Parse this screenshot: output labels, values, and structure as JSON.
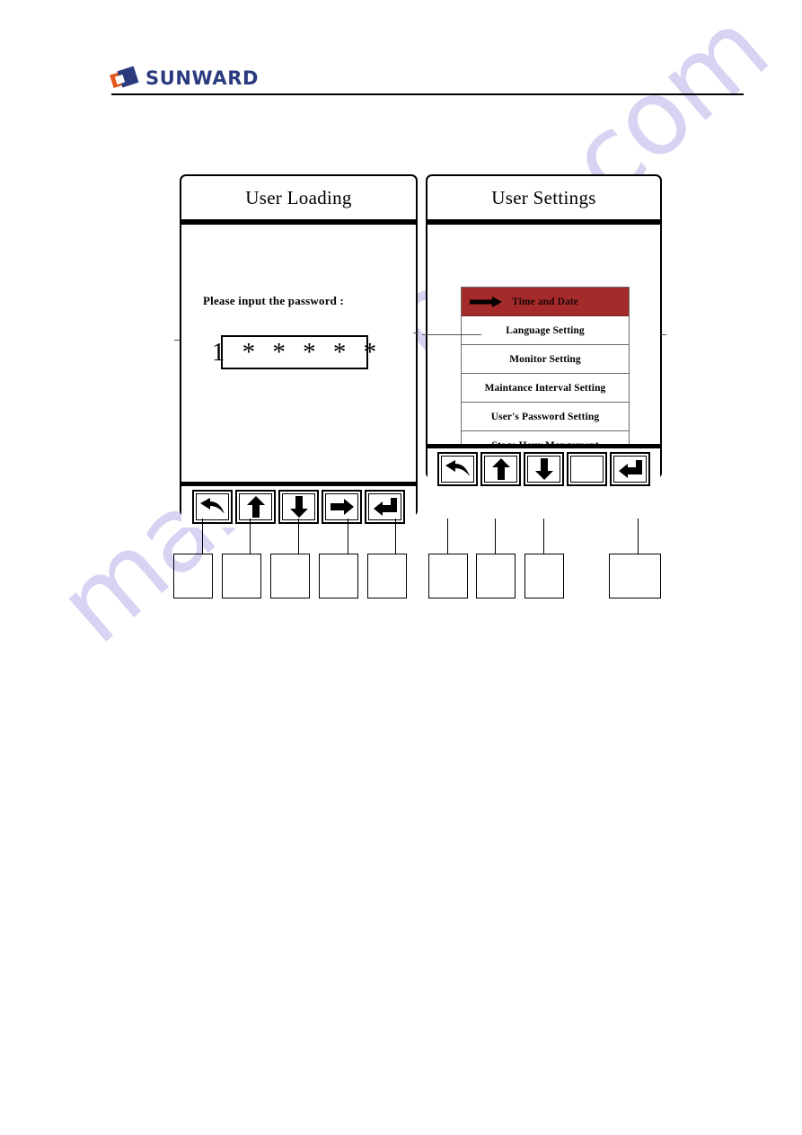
{
  "header": {
    "brand": "SUNWARD",
    "logo_icon": "sunward-diamond-logo",
    "brand_color": "#2b3b80",
    "accent_color": "#e2581f"
  },
  "watermark": {
    "text": "manualshive.com",
    "color": "#c9c6ee"
  },
  "panels": {
    "left": {
      "title": "User Loading",
      "prompt": "Please input the password :",
      "password_value": "1 * * * * *",
      "keys": [
        {
          "label": "",
          "icon": "back-arrow-icon",
          "name": "key-back"
        },
        {
          "label": "",
          "icon": "up-arrow-icon",
          "name": "key-up"
        },
        {
          "label": "",
          "icon": "down-arrow-icon",
          "name": "key-down"
        },
        {
          "label": "",
          "icon": "right-arrow-icon",
          "name": "key-right"
        },
        {
          "label": "",
          "icon": "enter-key-icon",
          "name": "key-enter"
        }
      ]
    },
    "right": {
      "title": "User Settings",
      "selected_row_color": "#a52a2a",
      "cursor_icon": "right-pointer-arrow-icon",
      "menu": [
        {
          "label": "Time and Date",
          "selected": true
        },
        {
          "label": "Language Setting",
          "selected": false
        },
        {
          "label": "Monitor Setting",
          "selected": false
        },
        {
          "label": "Maintance Interval Setting",
          "selected": false
        },
        {
          "label": "User's Password Setting",
          "selected": false
        },
        {
          "label": "Stage Hour Mangement",
          "selected": false
        },
        {
          "label": "",
          "selected": false
        }
      ],
      "keys": [
        {
          "label": "",
          "icon": "back-arrow-icon",
          "name": "key-back"
        },
        {
          "label": "",
          "icon": "up-arrow-icon",
          "name": "key-up"
        },
        {
          "label": "",
          "icon": "down-arrow-icon",
          "name": "key-down"
        },
        {
          "label": "",
          "icon": "blank-key-icon",
          "name": "key-blank"
        },
        {
          "label": "",
          "icon": "enter-key-icon",
          "name": "key-enter"
        }
      ]
    }
  },
  "callouts": {
    "left": [
      {
        "label": ""
      },
      {
        "label": ""
      },
      {
        "label": ""
      },
      {
        "label": ""
      },
      {
        "label": ""
      }
    ],
    "right": [
      {
        "label": ""
      },
      {
        "label": ""
      },
      {
        "label": ""
      },
      {
        "label": ""
      }
    ]
  }
}
